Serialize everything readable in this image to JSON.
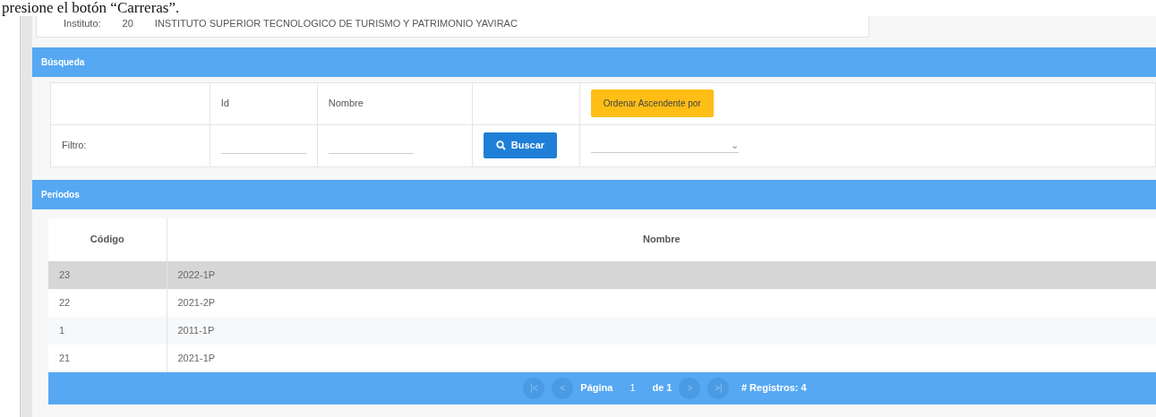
{
  "caption": "presione el botón “Carreras”.",
  "instituto": {
    "label": "Instituto:",
    "code": "20",
    "name": "INSTITUTO SUPERIOR TECNOLOGICO DE TURISMO Y PATRIMONIO YAVIRAC"
  },
  "busqueda": {
    "title": "Búsqueda",
    "columns": [
      "Id",
      "Nombre"
    ],
    "sort_button": "Ordenar Ascendente por",
    "filter_label": "Filtro:",
    "search_button": "Buscar",
    "dropdown_arrow": "⌄"
  },
  "periodos": {
    "title": "Periodos",
    "columns": [
      "Código",
      "Nombre"
    ],
    "rows": [
      {
        "codigo": "23",
        "nombre": "2022-1P",
        "selected": true
      },
      {
        "codigo": "22",
        "nombre": "2021-2P",
        "selected": false
      },
      {
        "codigo": "1",
        "nombre": "2011-1P",
        "selected": false
      },
      {
        "codigo": "21",
        "nombre": "2021-1P",
        "selected": false
      }
    ],
    "paginator": {
      "first": "|<",
      "prev": "<",
      "page_label": "Página",
      "page_value": "1",
      "of_label": "de 1",
      "next": ">",
      "last": ">|",
      "records": "# Registros: 4"
    }
  }
}
